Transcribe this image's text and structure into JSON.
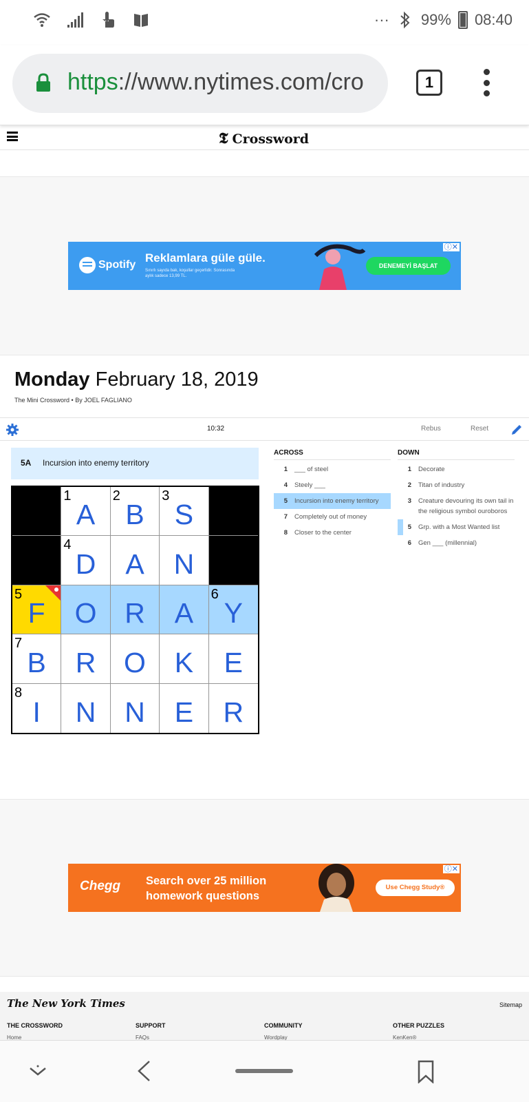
{
  "status_bar": {
    "battery": "99%",
    "time": "08:40",
    "more": "···"
  },
  "browser": {
    "url_scheme": "https",
    "url_rest": "://www.nytimes.com/cro",
    "tab_count": "1"
  },
  "site": {
    "brand": "Crossword",
    "brand_glyph": "𝕿"
  },
  "ad_spotify": {
    "logo": "Spotify",
    "headline": "Reklamlara güle güle.",
    "subtext": "Sınırlı sayıda bak, koşullar geçerlidir. Sonrasında aylık sadece 13,99 TL.",
    "cta": "DENEMEYİ BAŞLAT",
    "brand_color": "#3d9cf0"
  },
  "puzzle": {
    "day": "Monday",
    "date": "February 18, 2019",
    "title": "The Mini Crossword",
    "author": "By JOEL FAGLIANO",
    "byline_sep": "•",
    "timer": "10:32",
    "rebus_label": "Rebus",
    "reset_label": "Reset",
    "current_clue": {
      "num": "5A",
      "text": "Incursion into enemy territory"
    },
    "grid": [
      [
        {
          "type": "black"
        },
        {
          "num": "1",
          "letter": "A"
        },
        {
          "num": "2",
          "letter": "B"
        },
        {
          "num": "3",
          "letter": "S"
        },
        {
          "type": "black"
        }
      ],
      [
        {
          "type": "black"
        },
        {
          "num": "4",
          "letter": "D"
        },
        {
          "letter": "A"
        },
        {
          "letter": "N"
        },
        {
          "type": "black"
        }
      ],
      [
        {
          "num": "5",
          "letter": "F",
          "state": "selected"
        },
        {
          "letter": "O",
          "state": "highlight"
        },
        {
          "letter": "R",
          "state": "highlight"
        },
        {
          "letter": "A",
          "state": "highlight"
        },
        {
          "num": "6",
          "letter": "Y",
          "state": "highlight"
        }
      ],
      [
        {
          "num": "7",
          "letter": "B"
        },
        {
          "letter": "R"
        },
        {
          "letter": "O"
        },
        {
          "letter": "K"
        },
        {
          "letter": "E"
        }
      ],
      [
        {
          "num": "8",
          "letter": "I"
        },
        {
          "letter": "N"
        },
        {
          "letter": "N"
        },
        {
          "letter": "E"
        },
        {
          "letter": "R"
        }
      ]
    ],
    "across_heading": "ACROSS",
    "down_heading": "DOWN",
    "across": [
      {
        "num": "1",
        "text": "___ of steel"
      },
      {
        "num": "4",
        "text": "Steely ___"
      },
      {
        "num": "5",
        "text": "Incursion into enemy territory",
        "state": "active"
      },
      {
        "num": "7",
        "text": "Completely out of money"
      },
      {
        "num": "8",
        "text": "Closer to the center"
      }
    ],
    "down": [
      {
        "num": "1",
        "text": "Decorate"
      },
      {
        "num": "2",
        "text": "Titan of industry"
      },
      {
        "num": "3",
        "text": "Creature devouring its own tail in the religious symbol ouroboros"
      },
      {
        "num": "5",
        "text": "Grp. with a Most Wanted list",
        "state": "cross"
      },
      {
        "num": "6",
        "text": "Gen ___ (millennial)"
      }
    ],
    "colors": {
      "highlight": "#a7d8ff",
      "selected": "#ffda00",
      "letter": "#2860d8"
    }
  },
  "ad_chegg": {
    "logo": "Chegg",
    "headline": "Search over 25 million homework questions",
    "cta": "Use Chegg Study®",
    "brand_color": "#f5721f"
  },
  "footer": {
    "logo": "The New York Times",
    "sitemap": "Sitemap",
    "columns": [
      {
        "heading": "THE CROSSWORD",
        "link": "Home"
      },
      {
        "heading": "SUPPORT",
        "link": "FAQs"
      },
      {
        "heading": "COMMUNITY",
        "link": "Wordplay"
      },
      {
        "heading": "OTHER PUZZLES",
        "link": "KenKen®"
      }
    ]
  }
}
